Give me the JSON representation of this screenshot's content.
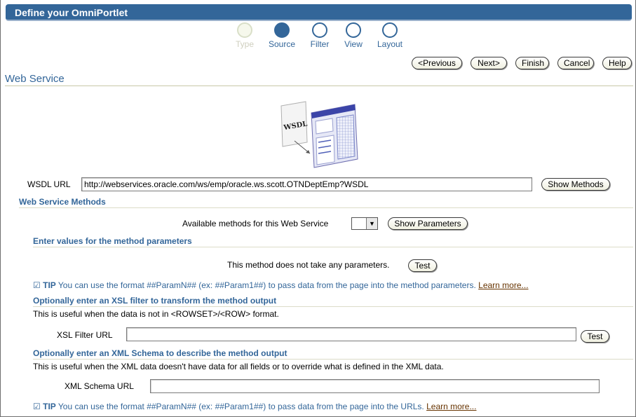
{
  "window": {
    "title": "Define your OmniPortlet"
  },
  "train": {
    "steps": [
      {
        "label": "Type"
      },
      {
        "label": "Source"
      },
      {
        "label": "Filter"
      },
      {
        "label": "View"
      },
      {
        "label": "Layout"
      }
    ],
    "current": "Source"
  },
  "nav": {
    "previous": "<Previous",
    "next": "Next>",
    "finish": "Finish",
    "cancel": "Cancel",
    "help": "Help"
  },
  "page": {
    "heading": "Web Service"
  },
  "graphic": {
    "wsdl_text": "WSDL"
  },
  "wsdl": {
    "label": "WSDL URL",
    "value": "http://webservices.oracle.com/ws/emp/oracle.ws.scott.OTNDeptEmp?WSDL",
    "show_methods": "Show Methods"
  },
  "methods": {
    "heading": "Web Service Methods",
    "available_label": "Available methods for this Web Service",
    "selected": "",
    "show_parameters": "Show Parameters"
  },
  "params": {
    "heading": "Enter values for the method parameters",
    "message": "This method does not take any parameters.",
    "test": "Test",
    "tip_label": "TIP",
    "tip_text": "You can use the format ##ParamN## (ex: ##Param1##) to pass data from the page into the method parameters.",
    "learn_more": "Learn more..."
  },
  "xsl": {
    "heading": "Optionally enter an XSL filter to transform the method output",
    "desc": "This is useful when the data is not in <ROWSET>/<ROW> format.",
    "label": "XSL Filter URL",
    "value": "",
    "test": "Test"
  },
  "schema": {
    "heading": "Optionally enter an XML Schema to describe the method output",
    "desc": "This is useful when the XML data doesn't have data for all fields or to override what is defined in the XML data.",
    "label": "XML Schema URL",
    "value": "",
    "tip_label": "TIP",
    "tip_text": "You can use the format ##ParamN## (ex: ##Param1##) to pass data from the page into the URLs.",
    "learn_more": "Learn more..."
  },
  "colors": {
    "brand": "#336699",
    "link": "#663300"
  }
}
